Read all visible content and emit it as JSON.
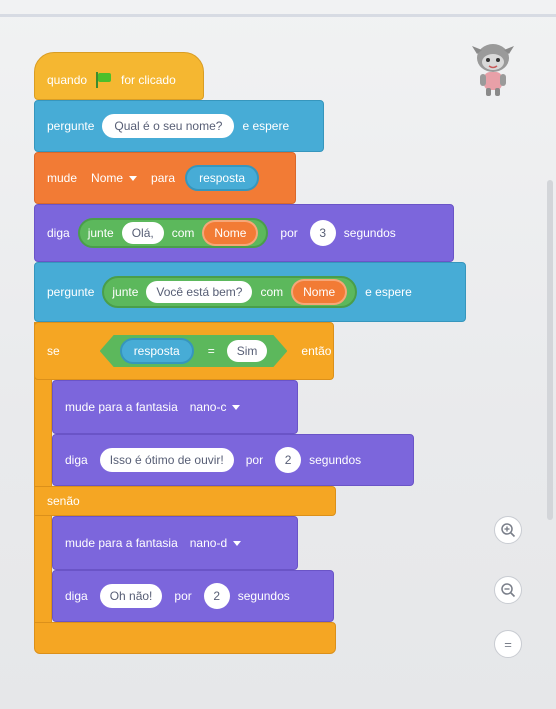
{
  "script": {
    "hat": {
      "when": "quando",
      "clicked": "for clicado"
    },
    "ask1": {
      "label": "pergunte",
      "question": "Qual é o seu nome?",
      "wait": "e espere"
    },
    "set": {
      "label": "mude",
      "variable": "Nome",
      "to": "para",
      "value": "resposta"
    },
    "say1": {
      "label": "diga",
      "join": "junte",
      "part1": "Olá,",
      "with": "com",
      "part2": "Nome",
      "for": "por",
      "secs": "3",
      "seconds": "segundos"
    },
    "ask2": {
      "label": "pergunte",
      "join": "junte",
      "part1": "Você está bem?",
      "with": "com",
      "part2": "Nome",
      "wait": "e espere"
    },
    "if": {
      "label": "se",
      "left": "resposta",
      "op": "=",
      "right": "Sim",
      "then": "então"
    },
    "costume1": {
      "label": "mude para a fantasia",
      "costume": "nano-c"
    },
    "say2": {
      "label": "diga",
      "text": "Isso é ótimo de ouvir!",
      "for": "por",
      "secs": "2",
      "seconds": "segundos"
    },
    "else": {
      "label": "senão"
    },
    "costume2": {
      "label": "mude para a fantasia",
      "costume": "nano-d"
    },
    "say3": {
      "label": "diga",
      "text": "Oh não!",
      "for": "por",
      "secs": "2",
      "seconds": "segundos"
    }
  },
  "zoom_controls": {
    "zoom_in": "zoom-in-icon",
    "zoom_out": "zoom-out-icon",
    "reset": "="
  },
  "colors": {
    "events": "#f5b731",
    "sensing": "#47acd6",
    "variables": "#f27b35",
    "looks": "#7c66dc",
    "control": "#f5a623",
    "operators": "#5cb85c"
  }
}
